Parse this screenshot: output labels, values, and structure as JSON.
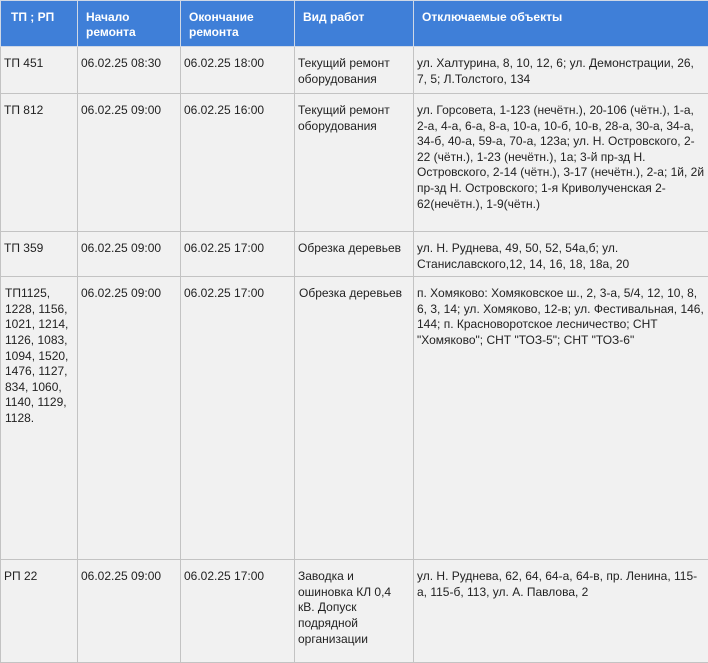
{
  "header": {
    "col1": "ТП ; РП",
    "col2": "Начало ремонта",
    "col3": "Окончание ремонта",
    "col4": "Вид работ",
    "col5": "Отключаемые объекты"
  },
  "rows": [
    {
      "tp": "ТП 451",
      "start": "06.02.25 08:30",
      "end": "06.02.25 18:00",
      "work": "Текущий ремонт оборудования",
      "objects": "ул. Халтурина, 8, 10, 12, 6; ул. Демонстрации, 26, 7, 5; Л.Толстого, 134"
    },
    {
      "tp": "ТП 812",
      "start": "06.02.25 09:00",
      "end": "06.02.25 16:00",
      "work": "Текущий ремонт оборудования",
      "objects": "ул. Горсовета, 1-123 (нечётн.), 20-106 (чётн.), 1-а, 2-а, 4-а, 6-а, 8-а, 10-а, 10-б, 10-в, 28-а, 30-а, 34-а, 34-б, 40-а, 59-а, 70-а, 123а; ул. Н. Островского, 2-22 (чётн.), 1-23 (нечётн.), 1а; 3-й пр-зд Н. Островского, 2-14 (чётн.), 3-17 (нечётн.), 2-а; 1й, 2й пр-зд Н. Островского; 1-я Криволученская 2-62(нечётн.), 1-9(чётн.)"
    },
    {
      "tp": "ТП 359",
      "start": "06.02.25 09:00",
      "end": "06.02.25 17:00",
      "work": "Обрезка деревьев",
      "objects": "ул. Н. Руднева, 49, 50, 52, 54а,б; ул. Станиславского,12, 14, 16, 18, 18а, 20"
    },
    {
      "tp": "ТП1125, 1228, 1156, 1021, 1214, 1126, 1083, 1094, 1520, 1476, 1127, 834, 1060, 1140, 1129, 1128.",
      "start": "06.02.25 09:00",
      "end": "06.02.25 17:00",
      "work": "Обрезка деревьев",
      "objects": "п. Хомяково: Хомяковское ш., 2, 3-а, 5/4, 12, 10, 8, 6, 3, 14; ул. Хомяково, 12-в; ул. Фестивальная, 146, 144; п. Красноворотское лесничество; СНТ \"Хомяково\"; СНТ \"ТОЗ-5\"; СНТ \"ТОЗ-6\""
    },
    {
      "tp": "РП 22",
      "start": "06.02.25 09:00",
      "end": "06.02.25 17:00",
      "work": "Заводка и ошиновка КЛ 0,4 кВ. Допуск подрядной организации",
      "objects": "ул. Н. Руднева, 62, 64, 64-а, 64-в, пр. Ленина, 115-а, 115-б, 113, ул. А. Павлова, 2"
    }
  ]
}
